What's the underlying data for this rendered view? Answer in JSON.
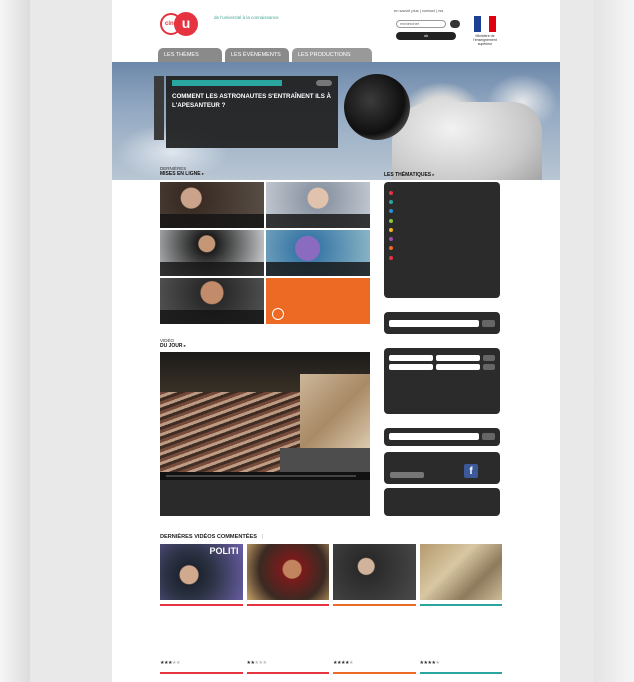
{
  "header": {
    "logo_text": "u",
    "logo_small": "cine",
    "tagline": "de l'université à la connaissance",
    "toplinks": "en savoir plus   |   contact   |   rss",
    "search_placeholder": "rechercher",
    "button": "ok",
    "flag_caption": "Ministère de l'enseignement supérieur"
  },
  "nav": {
    "tabs": [
      "LES THÈMES",
      "LES ÉVÈNEMENTS",
      "LES PRODUCTIONS"
    ]
  },
  "hero": {
    "kicker": "",
    "category": "",
    "title": "COMMENT LES ASTRONAUTES S'ENTRAÎNENT ILS À L'APESANTEUR ?",
    "more": ""
  },
  "latest": {
    "label_small": "DERNIÈRES",
    "label_big": "MISES EN LIGNE",
    "items": [
      {
        "caption": ""
      },
      {
        "caption": ""
      },
      {
        "caption": ""
      },
      {
        "caption": ""
      },
      {
        "caption": ""
      },
      {
        "caption": ""
      }
    ],
    "featured": {
      "title": "",
      "sub": ""
    }
  },
  "video": {
    "label_small": "VIDÉO",
    "label_big": "DU JOUR",
    "line1": "",
    "line2": "",
    "meta": ""
  },
  "themes": {
    "label": "LES THÉMATIQUES",
    "items": [
      {
        "label": "",
        "color": "#e5333f"
      },
      {
        "label": "",
        "color": "#29a6a0"
      },
      {
        "label": "",
        "color": "#2a8fd6"
      },
      {
        "label": "",
        "color": "#8cc63f"
      },
      {
        "label": "",
        "color": "#f2b61c"
      },
      {
        "label": "",
        "color": "#9b4fa8"
      },
      {
        "label": "",
        "color": "#ec6a23"
      },
      {
        "label": "",
        "color": "#e5333f"
      }
    ]
  },
  "programme": {
    "label": "",
    "placeholder": ""
  },
  "cine": {
    "label": "",
    "l1": "",
    "l2": "",
    "l3": "",
    "s1": "",
    "s2": "",
    "s3": "",
    "s4": "",
    "more": ""
  },
  "newsletter": {
    "label": "",
    "placeholder": ""
  },
  "social": {
    "text": "",
    "button": "",
    "follow": "",
    "fb": "f"
  },
  "cloud": {
    "words": []
  },
  "commented": {
    "title": "DERNIÈRES VIDÉOS COMMENTÉES",
    "alt": "",
    "cards": [
      {
        "badge": "POLITI",
        "title": "",
        "desc": "",
        "rating": 3,
        "count": "",
        "accent": "#e5333f"
      },
      {
        "badge": "",
        "title": "",
        "desc": "",
        "rating": 2,
        "count": "",
        "accent": "#e5333f"
      },
      {
        "badge": "",
        "title": "",
        "desc": "",
        "rating": 4,
        "count": "",
        "accent": "#ec6a23"
      },
      {
        "badge": "",
        "title": "",
        "desc": "",
        "rating": 4,
        "count": "",
        "accent": "#29a6a0"
      }
    ]
  }
}
